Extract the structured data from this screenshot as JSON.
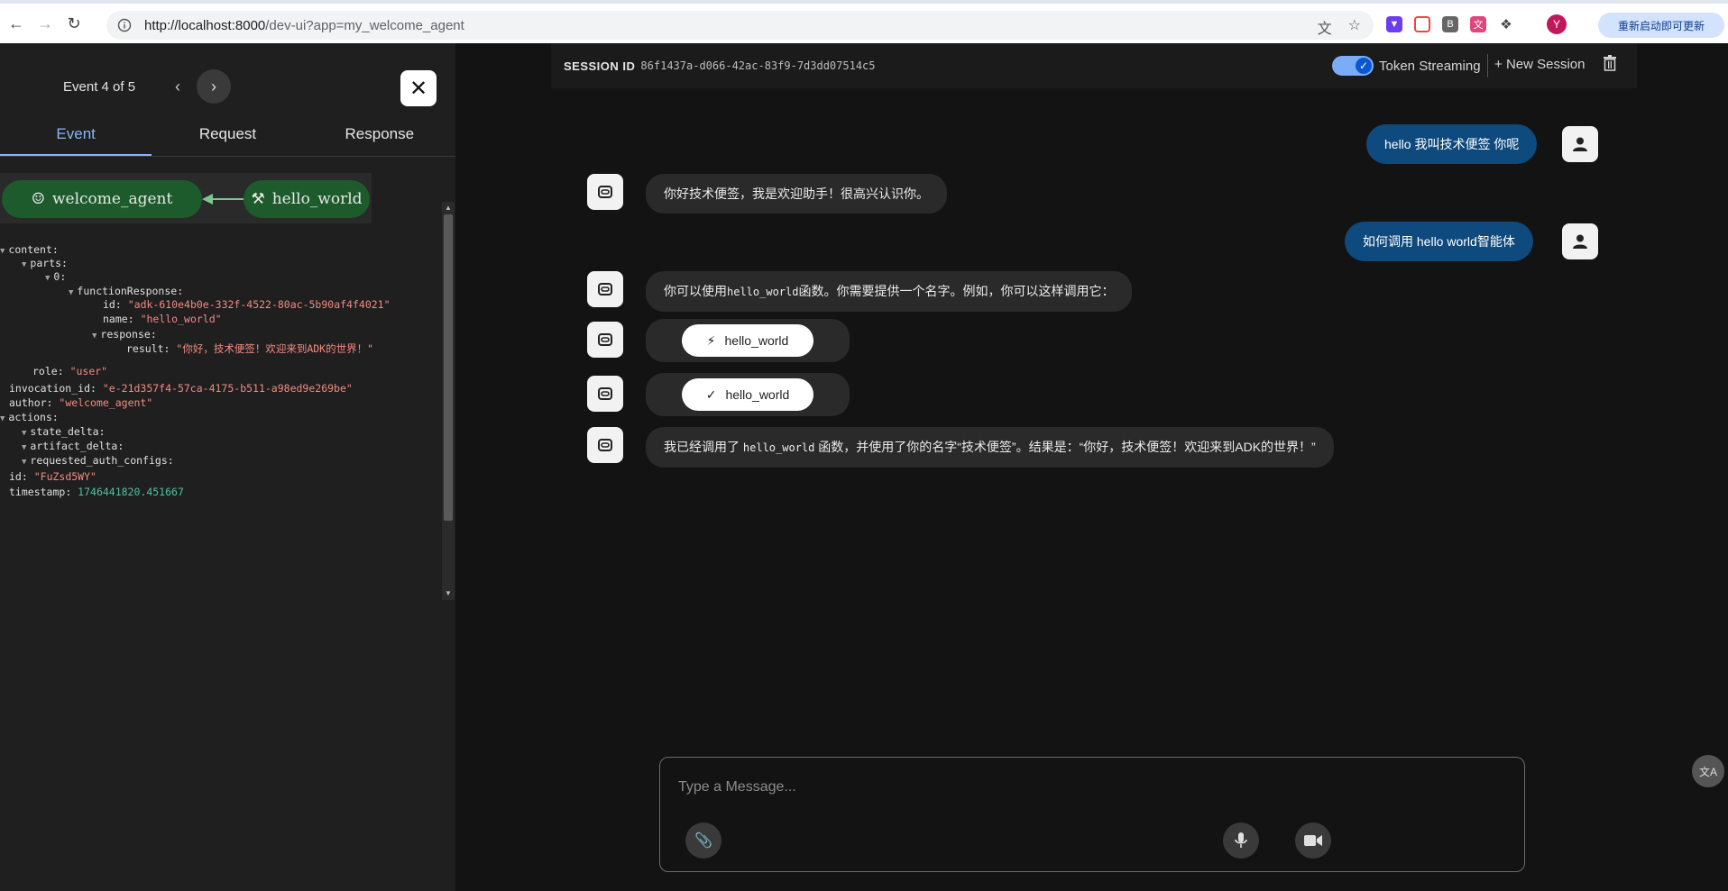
{
  "browser": {
    "url_host": "http://localhost:8000",
    "url_path": "/dev-ui?app=my_welcome_agent",
    "profile_initial": "Y",
    "update_button": "重新启动即可更新",
    "ext_b_label": "B"
  },
  "trace": {
    "event_counter": "Event 4 of 5",
    "tabs": [
      "Event",
      "Request",
      "Response"
    ],
    "graph": {
      "node_agent": "welcome_agent",
      "node_tool": "hello_world"
    },
    "json": {
      "content": "content",
      "parts": "parts",
      "index0": "0",
      "functionResponse": "functionResponse",
      "id_key": "id",
      "id_val": "\"adk-610e4b0e-332f-4522-80ac-5b90af4f4021\"",
      "name_key": "name",
      "name_val": "\"hello_world\"",
      "response_key": "response",
      "result_key": "result",
      "result_val": "\"你好，技术便签！欢迎来到ADK的世界！\"",
      "role_key": "role",
      "role_val": "\"user\"",
      "invocation_key": "invocation_id",
      "invocation_val": "\"e-21d357f4-57ca-4175-b511-a98ed9e269be\"",
      "author_key": "author",
      "author_val": "\"welcome_agent\"",
      "actions_key": "actions",
      "state_delta": "state_delta",
      "artifact_delta": "artifact_delta",
      "requested_auth_configs": "requested_auth_configs",
      "event_id_key": "id",
      "event_id_val": "\"FuZsd5WY\"",
      "timestamp_key": "timestamp",
      "timestamp_val": "1746441820.451667"
    }
  },
  "session": {
    "label": "SESSION ID",
    "id": "86f1437a-d066-42ac-83f9-7d3dd07514c5",
    "token_streaming": "Token Streaming",
    "new_session": "New Session"
  },
  "messages": {
    "user1": "hello 我叫技术便签 你呢",
    "bot1": "你好技术便签，我是欢迎助手！很高兴认识你。",
    "user2": "如何调用 hello world智能体",
    "bot2_pre": "你可以使用",
    "bot2_code": "hello_world",
    "bot2_post": "函数。你需要提供一个名字。例如，你可以这样调用它：",
    "call_chip": "hello_world",
    "result_chip": "hello_world",
    "bot3_pre": "我已经调用了",
    "bot3_code": "hello_world",
    "bot3_post": "函数，并使用了你的名字“技术便签”。结果是：“你好，技术便签！欢迎来到ADK的世界！”"
  },
  "composer": {
    "placeholder": "Type a Message..."
  },
  "colors": {
    "user_bubble": "#0e4a7d",
    "bot_bubble": "#2a2a2b",
    "accent": "#8ab4f8",
    "graph_node": "#1d5b2c"
  }
}
